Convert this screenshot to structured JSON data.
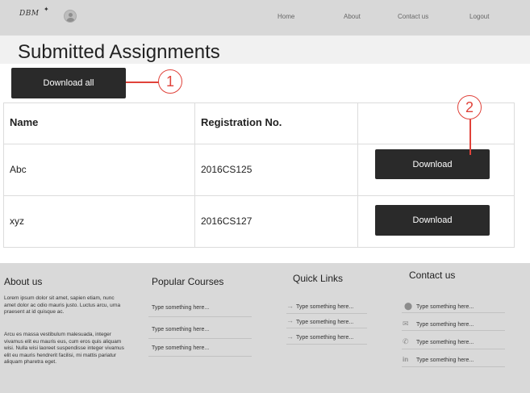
{
  "header": {
    "logo": "DBM",
    "nav": [
      "Home",
      "About",
      "Contact us",
      "Logout"
    ]
  },
  "page_title": "Submitted Assignments",
  "download_all_label": "Download all",
  "table": {
    "headers": [
      "Name",
      "Registration No."
    ],
    "rows": [
      {
        "name": "Abc",
        "reg": "2016CS125",
        "action": "Download"
      },
      {
        "name": "xyz",
        "reg": "2016CS127",
        "action": "Download"
      }
    ]
  },
  "callouts": [
    "1",
    "2"
  ],
  "footer": {
    "about": {
      "heading": "About us",
      "para1": "Lorem ipsum dolor sit amet, sapien etiam, nunc amet dolor ac odio mauris justo. Luctus arcu, urna praesent at id quisque ac.",
      "para2": "Arcu es massa vestibulum malesuada, integer vivamus elit eu mauris eus, cum eros quis aliquam wisi. Nulla wisi laoreet suspendisse integer vivamus elit eu mauris hendrerit facilisi, mi mattis pariatur aliquam pharetra eget."
    },
    "courses": {
      "heading": "Popular Courses",
      "items": [
        "Type something here...",
        "Type something here...",
        "Type something here..."
      ]
    },
    "links": {
      "heading": "Quick Links",
      "items": [
        "Type something here...",
        "Type something here...",
        "Type something here..."
      ]
    },
    "contact": {
      "heading": "Contact us",
      "items": [
        "Type something here...",
        "Type something here...",
        "Type something here...",
        "Type something here..."
      ]
    }
  },
  "colors": {
    "accent": "#e0423a",
    "button": "#2a2a2a",
    "header_bg": "#d8d8d8",
    "footer_bg": "#d9d9d9"
  }
}
